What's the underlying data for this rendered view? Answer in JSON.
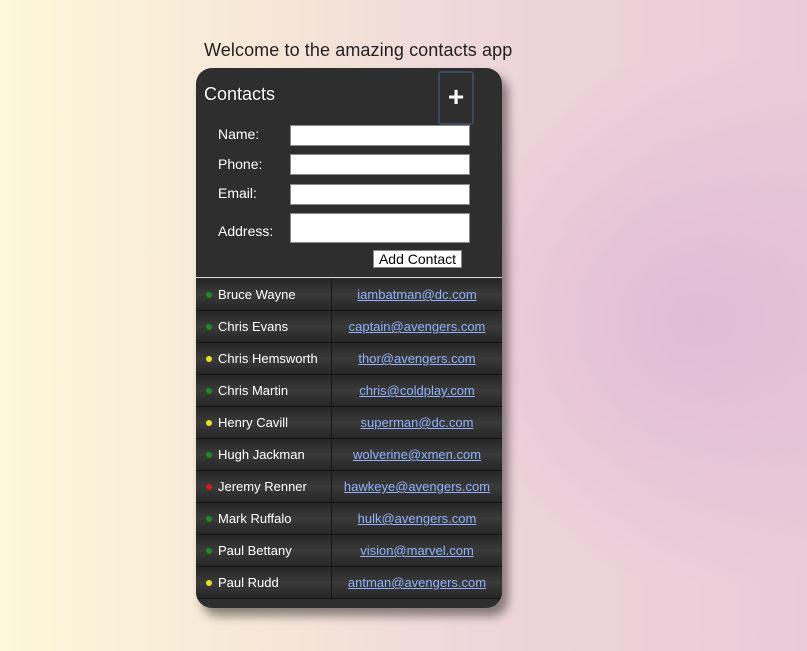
{
  "header": {
    "welcome": "Welcome to the amazing contacts app"
  },
  "card": {
    "title": "Contacts",
    "add_toggle_icon": "plus-icon",
    "add_toggle_label": "+"
  },
  "form": {
    "name_label": "Name:",
    "name_value": "",
    "phone_label": "Phone:",
    "phone_value": "",
    "email_label": "Email:",
    "email_value": "",
    "address_label": "Address:",
    "address_value": "",
    "submit_label": "Add Contact"
  },
  "status_colors": {
    "green": "#1f8a1f",
    "yellow": "#e8e02a",
    "red": "#d11a1a"
  },
  "contacts": [
    {
      "name": "Bruce Wayne",
      "email": "iambatman@dc.com",
      "status": "green"
    },
    {
      "name": "Chris Evans",
      "email": "captain@avengers.com",
      "status": "green"
    },
    {
      "name": "Chris Hemsworth",
      "email": "thor@avengers.com",
      "status": "yellow"
    },
    {
      "name": "Chris Martin",
      "email": "chris@coldplay.com",
      "status": "green"
    },
    {
      "name": "Henry Cavill",
      "email": "superman@dc.com",
      "status": "yellow"
    },
    {
      "name": "Hugh Jackman",
      "email": "wolverine@xmen.com",
      "status": "green"
    },
    {
      "name": "Jeremy Renner",
      "email": "hawkeye@avengers.com",
      "status": "red"
    },
    {
      "name": "Mark Ruffalo",
      "email": "hulk@avengers.com",
      "status": "green"
    },
    {
      "name": "Paul Bettany",
      "email": "vision@marvel.com",
      "status": "green"
    },
    {
      "name": "Paul Rudd",
      "email": "antman@avengers.com",
      "status": "yellow"
    }
  ]
}
